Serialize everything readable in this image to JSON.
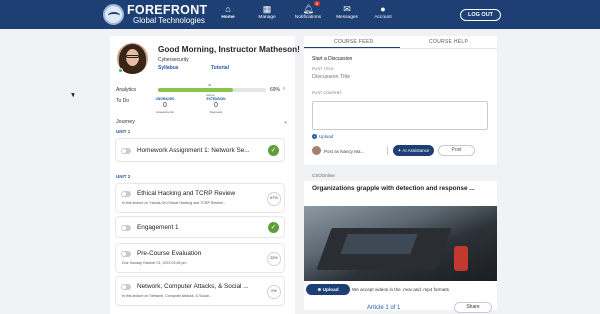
{
  "header": {
    "brand_line1": "FOREFRONT",
    "brand_line2": "Global Technologies",
    "nav": [
      {
        "label": "Home",
        "icon": "home-icon"
      },
      {
        "label": "Manage",
        "icon": "grid-icon"
      },
      {
        "label": "Notifications",
        "icon": "bell-icon",
        "badge": "6"
      },
      {
        "label": "Messages",
        "icon": "envelope-icon"
      },
      {
        "label": "Account",
        "icon": "user-icon"
      }
    ],
    "logout_label": "LOG OUT",
    "bar_color": "#1d3f73"
  },
  "profile": {
    "greeting": "Good Morning, Instructor Matheson!",
    "course": "Cybersecurity",
    "syllabus_link": "Syllabus",
    "tutorial_link": "Tutorial"
  },
  "analytics": {
    "label": "Analytics",
    "percent_text": "69%",
    "percent_value": 0.69,
    "marker_top": "4b",
    "marker_bottom": "Above"
  },
  "todo": {
    "label": "To Do",
    "columns": [
      {
        "head": "UNGRADED",
        "num": "0",
        "sub": "Assessments"
      },
      {
        "head": "EXTENSION",
        "num": "0",
        "sub": "Requests"
      }
    ]
  },
  "journey": {
    "label": "Journey",
    "units": [
      "UNIT 1",
      "UNIT 2"
    ],
    "items": [
      {
        "title": "Homework Assignment 1: Network Se...",
        "sub": "",
        "status": "check"
      },
      {
        "title": "Ethical Hacking and TCRP Review",
        "sub": "In this lecture on 'Hands-On Ethical Hacking and TCRP Review'...",
        "status": "ring",
        "ring_text": "67%"
      },
      {
        "title": "Engagement 1",
        "sub": "",
        "status": "check"
      },
      {
        "title": "Pre-Course Evaluation",
        "sub": "Due Sunday October 01, 2023 02:46 pm",
        "status": "ring",
        "ring_text": "22%"
      },
      {
        "title": "Network, Computer Attacks, & Social ...",
        "sub": "In this lecture on 'Network, Computer Attacks, & Social...",
        "status": "ring",
        "ring_text": "0%"
      }
    ]
  },
  "feed": {
    "tabs": [
      "COURSE FEED",
      "COURSE HELP"
    ],
    "start_label": "Start a Discussion",
    "post_title_label": "POST TITLE",
    "post_title_placeholder": "Discussion Title",
    "post_content_label": "POST CONTENT",
    "upload_label": "Upload",
    "post_as": "Post as Nancy Ma...",
    "ai_label": "AI Assistance",
    "post_button": "Post"
  },
  "news": {
    "source": "CSOOnline",
    "headline": "Organizations grapple with detection and response ...",
    "upload_button": "Upload",
    "accept_text": "We accept videos in the .mov and .mp4 formats",
    "pager": "Article 1 of 1",
    "share_button": "Share"
  }
}
